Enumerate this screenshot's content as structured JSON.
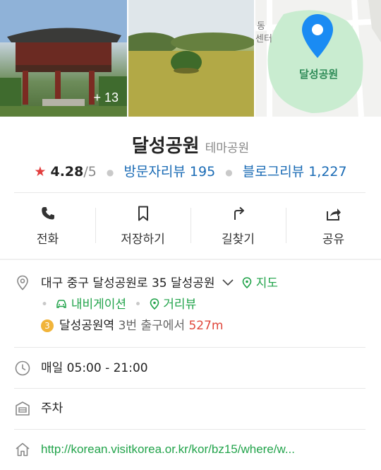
{
  "photos": {
    "count_badge": "+ 13"
  },
  "map": {
    "label_top": "동",
    "label_left": "센터",
    "place_label": "달성공원",
    "accent": "#1a8bf3"
  },
  "place": {
    "name": "달성공원",
    "category": "테마공원",
    "rating_score": "4.28",
    "rating_max": "/5",
    "visitor_reviews_label": "방문자리뷰 195",
    "blog_reviews_label": "블로그리뷰 1,227"
  },
  "actions": [
    {
      "label": "전화",
      "icon": "phone-icon"
    },
    {
      "label": "저장하기",
      "icon": "bookmark-icon"
    },
    {
      "label": "길찾기",
      "icon": "directions-icon"
    },
    {
      "label": "공유",
      "icon": "share-icon"
    }
  ],
  "address": {
    "text": "대구 중구 달성공원로 35 달성공원",
    "map_link": "지도",
    "navigation_link": "내비게이션",
    "streetview_link": "거리뷰"
  },
  "subway": {
    "line_number": "3",
    "station": "달성공원역",
    "exit_text": "3번 출구에서",
    "distance": "527m"
  },
  "hours": {
    "text": "매일 05:00 - 21:00"
  },
  "parking": {
    "text": "주차"
  },
  "website": {
    "url": "http://korean.visitkorea.or.kr/kor/bz15/where/w..."
  },
  "colors": {
    "green": "#21a34a",
    "blue": "#1a6bb5",
    "red": "#e0483d",
    "star": "#e23d3d"
  }
}
